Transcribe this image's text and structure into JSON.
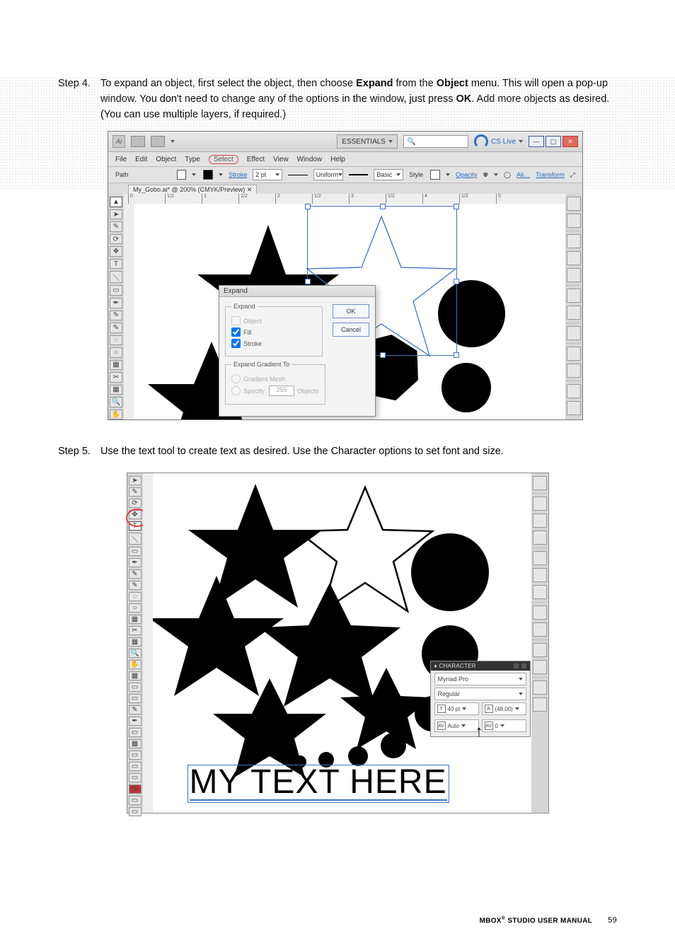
{
  "steps": {
    "s4_label": "Step    4.",
    "s4_text_a": "To expand an object, first select the object, then choose ",
    "s4_bold1": "Expand",
    "s4_text_b": " from the ",
    "s4_bold2": "Object",
    "s4_text_c": " menu. This will open a pop-up window. You don't need to change any of the options in the window, just press ",
    "s4_bold3": "OK",
    "s4_text_d": ". Add more objects as desired. (You can use multiple layers, if required.)",
    "s5_label": "Step    5.",
    "s5_text": "Use the text tool to create text as desired. Use the Character options to set font and size."
  },
  "shot1": {
    "ai_glyph": "Ai",
    "essentials": "ESSENTIALS",
    "search_icon": "🔍",
    "cslive": "CS Live",
    "win_min": "—",
    "win_max": "▢",
    "win_close": "✕",
    "menu": [
      "File",
      "Edit",
      "Object",
      "Type",
      "Select",
      "Effect",
      "View",
      "Window",
      "Help"
    ],
    "ctrl": {
      "path": "Path",
      "stroke": "Stroke",
      "stroke_val": "2 pt",
      "uniform": "Uniform",
      "basic": "Basic",
      "style": "Style",
      "opacity": "Opacity",
      "ali": "Ali…",
      "transform": "Transform"
    },
    "tab": "My_Gobo.ai* @ 200% (CMYK/Preview)",
    "tab_x": "✕",
    "ruler": [
      "0",
      "1/2",
      "1",
      "1/2",
      "2",
      "1/2",
      "3",
      "1/2",
      "4",
      "1/2",
      "5"
    ],
    "tools": [
      "▲",
      "➤",
      "✎",
      "⟳",
      "✥",
      "T",
      "＼",
      "▭",
      "✒",
      "✎",
      "✎",
      "◌",
      "○",
      "▦",
      "✂",
      "▦",
      "🔍",
      "✋",
      "▦",
      "▭"
    ],
    "rpanels": [
      "◉",
      "▭",
      "sep",
      "▦",
      "✥",
      "♣",
      "sep",
      "≡",
      "▭",
      "sep",
      "◉",
      "sep",
      "◉",
      "▭",
      "sep",
      "◆",
      "▭"
    ]
  },
  "dialog": {
    "title": "Expand",
    "legend1": "Expand",
    "opt_object": "Object",
    "opt_fill": "Fill",
    "opt_stroke": "Stroke",
    "legend2": "Expand Gradient To",
    "opt_mesh": "Gradient Mesh",
    "opt_specify": "Specify:",
    "specify_val": "255",
    "specify_unit": "Objects",
    "ok": "OK",
    "cancel": "Cancel"
  },
  "shot2": {
    "tools": [
      "➤",
      "✎",
      "⟳",
      "✥",
      "T",
      "＼",
      "▭",
      "✒",
      "✎",
      "✎",
      "◌",
      "○",
      "▦",
      "✂",
      "▦",
      "🔍",
      "✋",
      "▦",
      "▭",
      "▭",
      "✎",
      "✒",
      "▭",
      "▦",
      "▭",
      "▭",
      "▭",
      "✎",
      "▭",
      "▭",
      "▭"
    ],
    "rpanels": [
      "▭",
      "sep",
      "▦",
      "✥",
      "♣",
      "sep",
      "≡",
      "▭",
      "◉",
      "sep",
      "◉",
      "▭",
      "sep",
      "◆",
      "▭",
      "sep",
      "A",
      "¶"
    ],
    "char": {
      "title": "♦ CHARACTER",
      "font": "Myriad Pro",
      "style": "Regular",
      "size_ic": "T",
      "size": "40 pt",
      "lead_ic": "A",
      "lead": "(48.00)",
      "kern_ic": "AV",
      "kern": "Auto",
      "track_ic": "AV",
      "track": "0"
    },
    "arrow": "↑",
    "sample_text": "MY TEXT HERE"
  },
  "footer": {
    "title_a": "MBOX",
    "title_b": " STUDIO USER MANUAL",
    "page": "59"
  }
}
